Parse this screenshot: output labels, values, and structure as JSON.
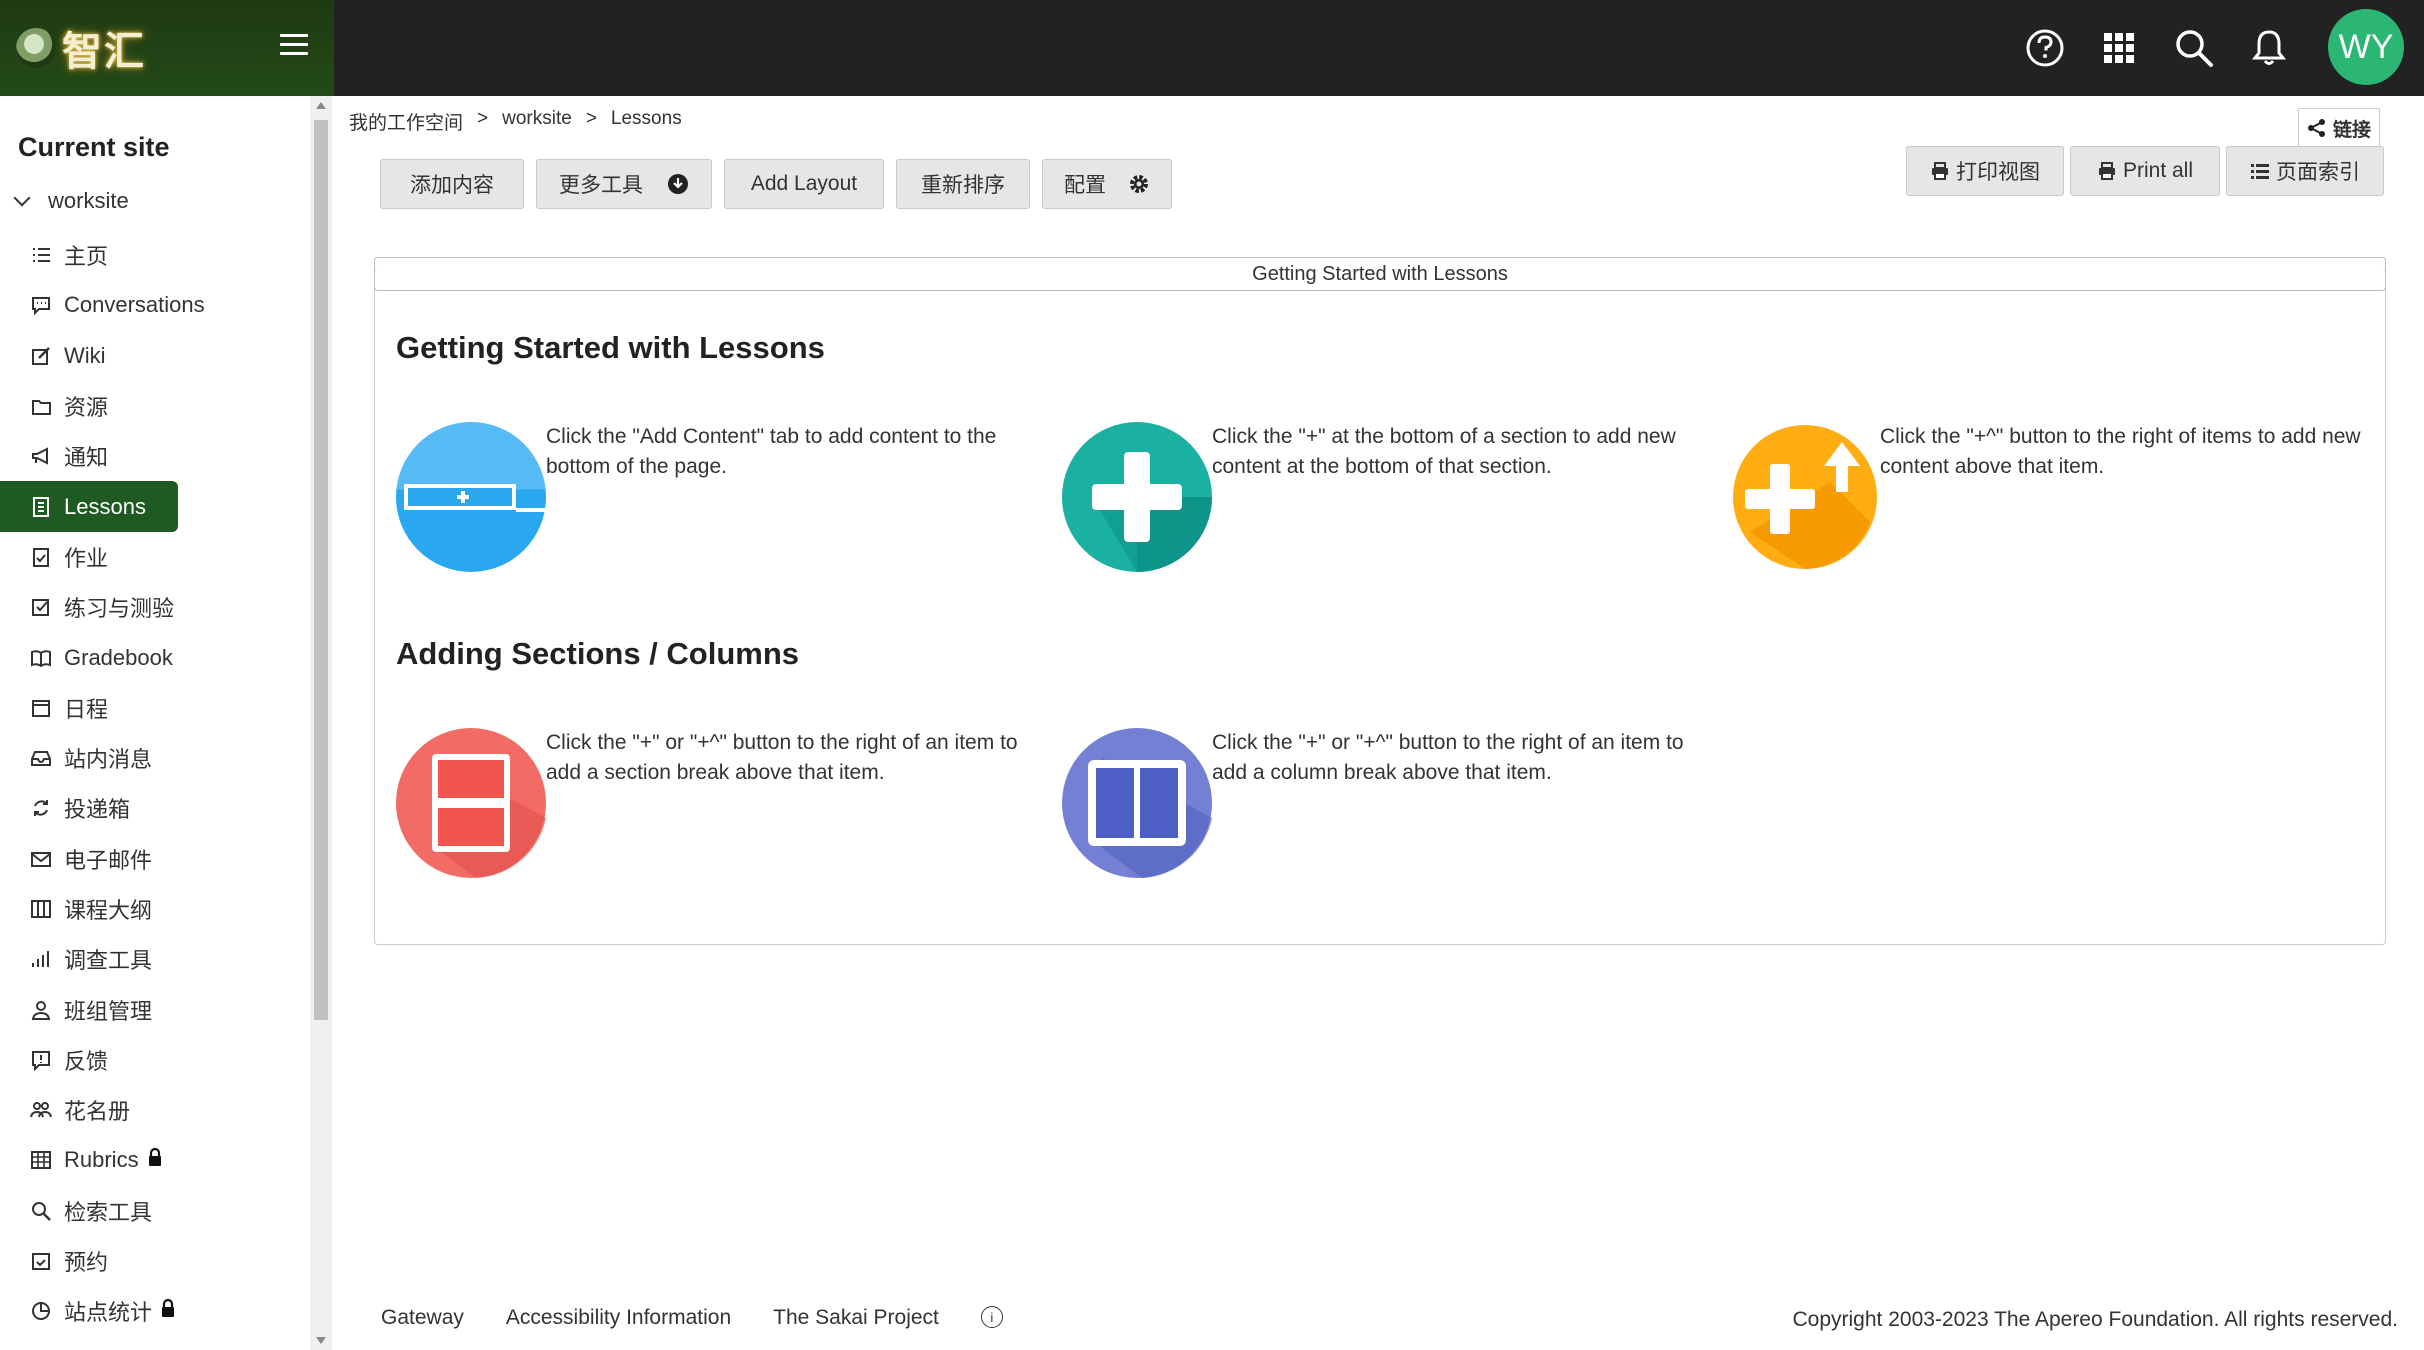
{
  "brand": {
    "logo_text": "智汇"
  },
  "header": {
    "avatar_initials": "WY"
  },
  "sidebar": {
    "current_site_label": "Current site",
    "site_name": "worksite",
    "items": [
      {
        "label": "主页",
        "icon": "list-icon"
      },
      {
        "label": "Conversations",
        "icon": "chat-icon"
      },
      {
        "label": "Wiki",
        "icon": "edit-icon"
      },
      {
        "label": "资源",
        "icon": "folder-icon"
      },
      {
        "label": "通知",
        "icon": "megaphone-icon"
      },
      {
        "label": "Lessons",
        "icon": "document-icon",
        "active": true
      },
      {
        "label": "作业",
        "icon": "assignment-icon"
      },
      {
        "label": "练习与测验",
        "icon": "checkbox-icon"
      },
      {
        "label": "Gradebook",
        "icon": "book-icon"
      },
      {
        "label": "日程",
        "icon": "calendar-icon"
      },
      {
        "label": "站内消息",
        "icon": "inbox-icon"
      },
      {
        "label": "投递箱",
        "icon": "sync-icon"
      },
      {
        "label": "电子邮件",
        "icon": "envelope-icon"
      },
      {
        "label": "课程大纲",
        "icon": "columns-icon"
      },
      {
        "label": "调查工具",
        "icon": "bar-chart-icon"
      },
      {
        "label": "班组管理",
        "icon": "person-icon"
      },
      {
        "label": "反馈",
        "icon": "feedback-icon"
      },
      {
        "label": "花名册",
        "icon": "people-icon"
      },
      {
        "label": "Rubrics",
        "icon": "table-icon",
        "locked": true
      },
      {
        "label": "检索工具",
        "icon": "search-icon"
      },
      {
        "label": "预约",
        "icon": "calendar-check-icon"
      },
      {
        "label": "站点统计",
        "icon": "pie-icon",
        "locked": true
      }
    ]
  },
  "breadcrumb": {
    "root": "我的工作空间",
    "sep": ">",
    "site": "worksite",
    "page": "Lessons"
  },
  "link_button": {
    "label": "链接"
  },
  "toolbar": {
    "add_content": "添加内容",
    "more_tools": "更多工具",
    "add_layout": "Add Layout",
    "reorder": "重新排序",
    "settings": "配置"
  },
  "right_toolbar": {
    "print_view": "打印视图",
    "print_all": "Print all",
    "page_index": "页面索引"
  },
  "panel": {
    "header": "Getting Started with Lessons",
    "section1_title": "Getting Started with Lessons",
    "section2_title": "Adding Sections / Columns",
    "cards": [
      {
        "text": "Click the \"Add Content\" tab to add content to the bottom of the page.",
        "color": "#29a8f0"
      },
      {
        "text": "Click the \"+\" at the bottom of a section to add new content at the bottom of that section.",
        "color": "#14a89a"
      },
      {
        "text": "Click the \"+^\" button to the right of items to add new content above that item.",
        "color": "#ffa90a"
      },
      {
        "text": "Click the \"+\" or \"+^\" button to the right of an item to add a section break above that item.",
        "color": "#f0605a"
      },
      {
        "text": "Click the \"+\" or \"+^\" button to the right of an item to add a column break above that item.",
        "color": "#5b6bc8"
      }
    ]
  },
  "footer": {
    "gateway": "Gateway",
    "accessibility": "Accessibility Information",
    "sakai": "The Sakai Project",
    "info": "i",
    "copyright": "Copyright 2003-2023 The Apereo Foundation. All rights reserved."
  }
}
